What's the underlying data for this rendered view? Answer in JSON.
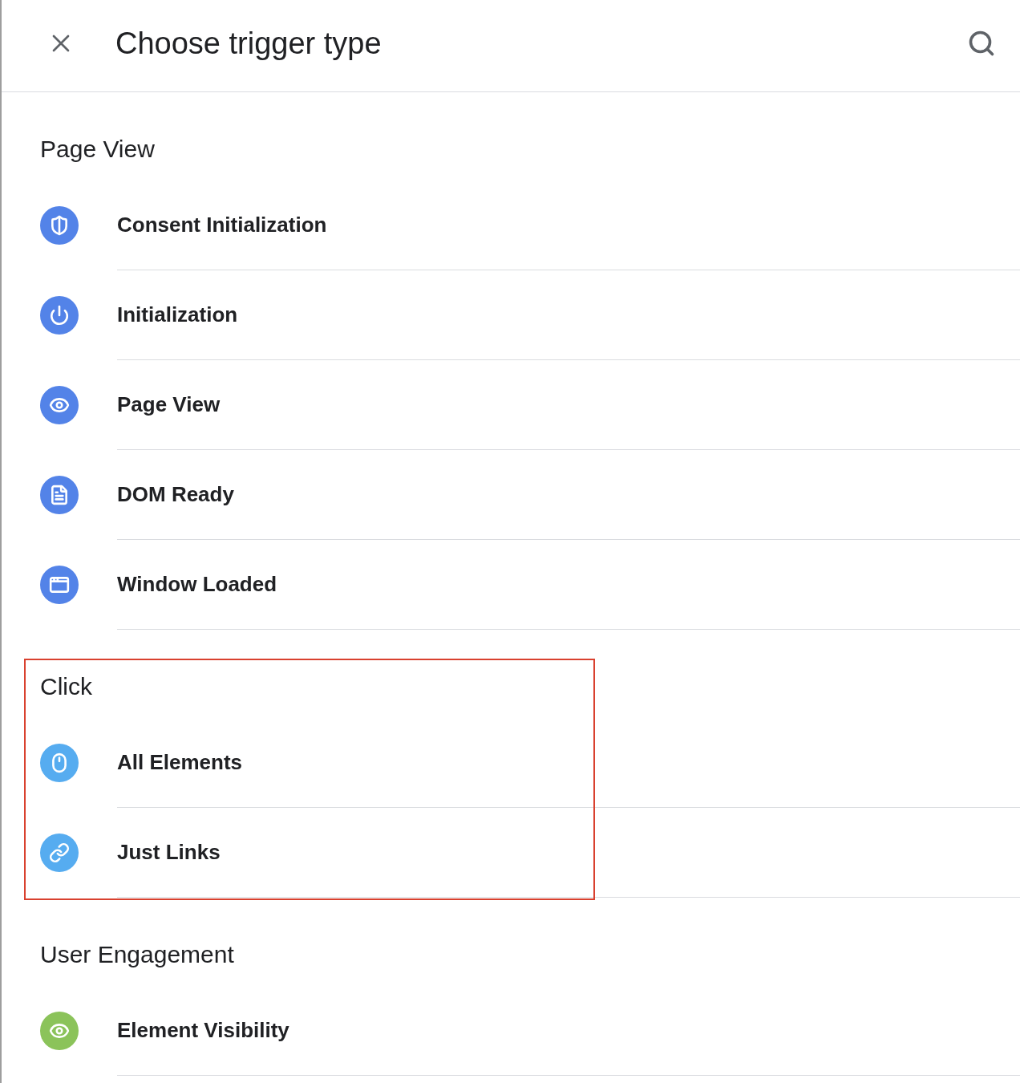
{
  "window": {
    "title": "Choose trigger type"
  },
  "sections": [
    {
      "heading": "Page View",
      "highlighted": false,
      "items": [
        {
          "label": "Consent Initialization",
          "color": "#5383e8"
        },
        {
          "label": "Initialization",
          "color": "#5383e8"
        },
        {
          "label": "Page View",
          "color": "#5383e8"
        },
        {
          "label": "DOM Ready",
          "color": "#5383e8"
        },
        {
          "label": "Window Loaded",
          "color": "#5383e8"
        }
      ]
    },
    {
      "heading": "Click",
      "highlighted": true,
      "items": [
        {
          "label": "All Elements",
          "color": "#56acf0"
        },
        {
          "label": "Just Links",
          "color": "#56acf0"
        }
      ]
    },
    {
      "heading": "User Engagement",
      "highlighted": false,
      "items": [
        {
          "label": "Element Visibility",
          "color": "#8bc35a"
        }
      ]
    }
  ]
}
